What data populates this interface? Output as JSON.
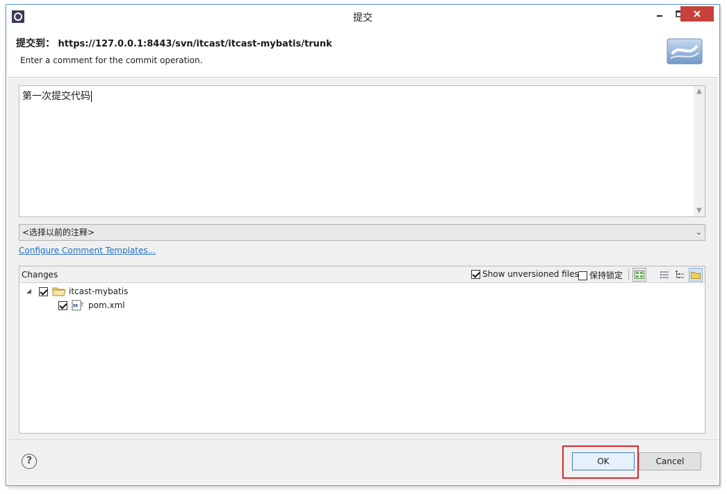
{
  "window": {
    "title": "提交",
    "accent": "#5d9ed6",
    "close_color": "#c7403a"
  },
  "header": {
    "label": "提交到：",
    "url": "https://127.0.0.1:8443/svn/itcast/itcast-mybatis/trunk",
    "description": "Enter a comment for the commit operation."
  },
  "comment": {
    "text": "第一次提交代码"
  },
  "previous_comments": {
    "selected": "<选择以前的注释>"
  },
  "templates_link": "Configure Comment Templates...",
  "changes": {
    "label": "Changes",
    "show_unversioned_label": "Show unversioned files",
    "show_unversioned_checked": true,
    "keep_locks_label": "保持锁定",
    "keep_locks_checked": false,
    "tree": [
      {
        "label": "itcast-mybatis",
        "checked": true,
        "expanded": true,
        "icon": "folder-icon"
      },
      {
        "label": "pom.xml",
        "checked": true,
        "icon": "maven-file-icon"
      }
    ]
  },
  "footer": {
    "ok_label": "OK",
    "cancel_label": "Cancel",
    "highlight_color": "#e0262a"
  }
}
